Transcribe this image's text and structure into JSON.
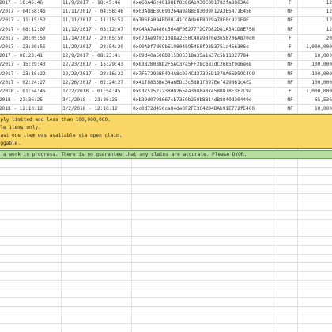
{
  "rows": [
    {
      "first_seen": "/9/2017 - 18:45:46",
      "last_seen": "11/9/2017 - 18:45:46",
      "tx": "0xe63A46c40198Ef8c86Ab930C0b1782fa8863A6",
      "type": "F",
      "amount": "12"
    },
    {
      "first_seen": "/11/2017 - 04:58:46",
      "last_seen": "11/11/2017 - 04:58:46",
      "tx": "0x03Ad8E8C693264a9a88E83039F12A3E5471E456",
      "type": "NF",
      "amount": "12"
    },
    {
      "first_seen": "/11/2017 - 11:15:52",
      "last_seen": "11/11/2017 - 11:15:52",
      "tx": "0x7B6Ea094ED30141CCAde6F8D29a78F0c921F9E",
      "type": "NF",
      "amount": "12"
    },
    {
      "first_seen": "/12/2017 - 08:12:07",
      "last_seen": "11/12/2017 - 08:12:07",
      "tx": "0xC4AA7a486c5648F0E27772C7D82D81A3A1D8E758",
      "type": "NF",
      "amount": "12"
    },
    {
      "first_seen": "/14/2017 - 20:05:50",
      "last_seen": "11/14/2017 - 20:05:50",
      "tx": "0x07dAe9f031088a2E50C40a9870e3658706A870c0",
      "type": "F",
      "amount": "20"
    },
    {
      "first_seen": "/29/2017 - 23:20:55",
      "last_seen": "11/29/2017 - 23:54:20",
      "tx": "0xC0ADf7d69bE19804595458f93B3751a456306e",
      "type": "F",
      "amount": "1,000,000"
    },
    {
      "first_seen": "/9/2017 - 08:23:41",
      "last_seen": "12/9/2017 - 08:23:41",
      "tx": "0xC9d40a506D91530631Ba35a1a37c5b11327784",
      "type": "NF",
      "amount": "10,000"
    },
    {
      "first_seen": "/23/2017 - 15:29:43",
      "last_seen": "12/23/2017 - 15:29:43",
      "tx": "0x83B2B03Bb2F5AC37a5FF28c683dC2685f9d6e68",
      "type": "NF",
      "amount": "100,000"
    },
    {
      "first_seen": "/23/2017 - 23:16:22",
      "last_seen": "12/23/2017 - 23:16:22",
      "tx": "0x7F57292BF494A8c934Cd37395D1378A65D59C499",
      "type": "NF",
      "amount": "100,000"
    },
    {
      "first_seen": "/26/2017 - 02:24:27",
      "last_seen": "12/26/2017 - 02:24:27",
      "tx": "0x41f8833Be34a6EDc3c58D1f597Eef429861c4E2",
      "type": "NF",
      "amount": "100,000"
    },
    {
      "first_seen": "/22/2018 - 01:54:45",
      "last_seen": "1/22/2018 - 01:54:45",
      "tx": "0x93751521238d02654a3888a07458B878F3F7C9a",
      "type": "F",
      "amount": "1,000,000"
    },
    {
      "first_seen": "/1/2018 - 23:36:25",
      "last_seen": "3/1/2018 - 23:36:25",
      "tx": "0xb39d0798667cb7359b250bB814dB8840d30440d",
      "type": "NF",
      "amount": "65,536"
    },
    {
      "first_seen": "/2/2018 - 12:10:12",
      "last_seen": "3/2/2018 - 12:10:12",
      "tx": "0xc0d72d45Cca84de0F2FE3C42D4BAb91E772fE4C0",
      "type": "NF",
      "amount": "10,000"
    }
  ],
  "notes": [
    "upply limited and less than 100,000,000.",
    "hole items only.",
    " least one item was available via open claim.",
    "ruggable."
  ],
  "disclaimer": " is a work in progress. There is no guarantee that any claims are accurate. Please DYOR."
}
